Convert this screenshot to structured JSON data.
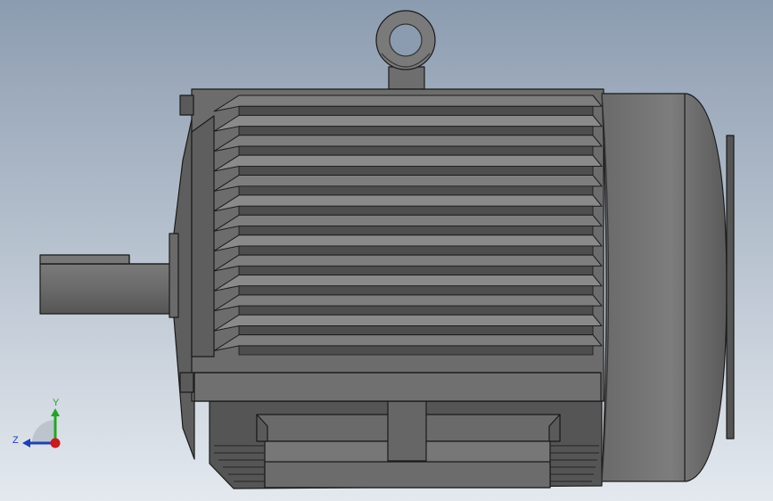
{
  "viewport": {
    "background_top": "#8c9cb0",
    "background_bottom": "#e4e9ef"
  },
  "model": {
    "body_color": "#6b6b6b",
    "edge_color": "#1a1a1a",
    "light_face": "#8a8a8a",
    "dark_face": "#4e4e4e",
    "fin_count": 13
  },
  "triad": {
    "y_label": "Y",
    "z_label": "Z",
    "y_color": "#1fa81f",
    "z_color": "#1f3fb8",
    "x_color": "#d01818"
  }
}
